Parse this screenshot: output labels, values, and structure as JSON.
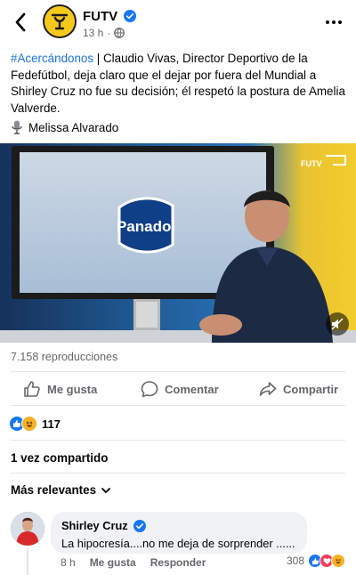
{
  "header": {
    "page_name": "FUTV",
    "time": "13 h",
    "time_separator": "·"
  },
  "post": {
    "hashtag": "#Acercándonos",
    "text": " | Claudio Vivas, Director Deportivo de la Fedefútbol, deja claro que el dejar por fuera del Mundial a Shirley Cruz no fue su decisión; él respetó la postura de Amelia Valverde.",
    "author_icon": "microphone-icon",
    "author": "Melissa Alvarado"
  },
  "video": {
    "monitor_brand": "Panadol",
    "watermark_line1": "FUTV"
  },
  "stats": {
    "views": "7.158 reproducciones",
    "reaction_count": "117",
    "shares": "1 vez compartido"
  },
  "actions": {
    "like": "Me gusta",
    "comment": "Comentar",
    "share": "Compartir"
  },
  "comments": {
    "sort_label": "Más relevantes",
    "items": [
      {
        "author": "Shirley Cruz",
        "text": "La hipocresía....no me deja de sorprender ......",
        "time": "8 h",
        "like": "Me gusta",
        "reply": "Responder",
        "reaction_count": "308"
      }
    ]
  },
  "colors": {
    "accent": "#1b74e4",
    "muted": "#65676b",
    "like_blue": "#1877f2",
    "love_red": "#f33e58",
    "haha_yellow": "#f7b125"
  }
}
